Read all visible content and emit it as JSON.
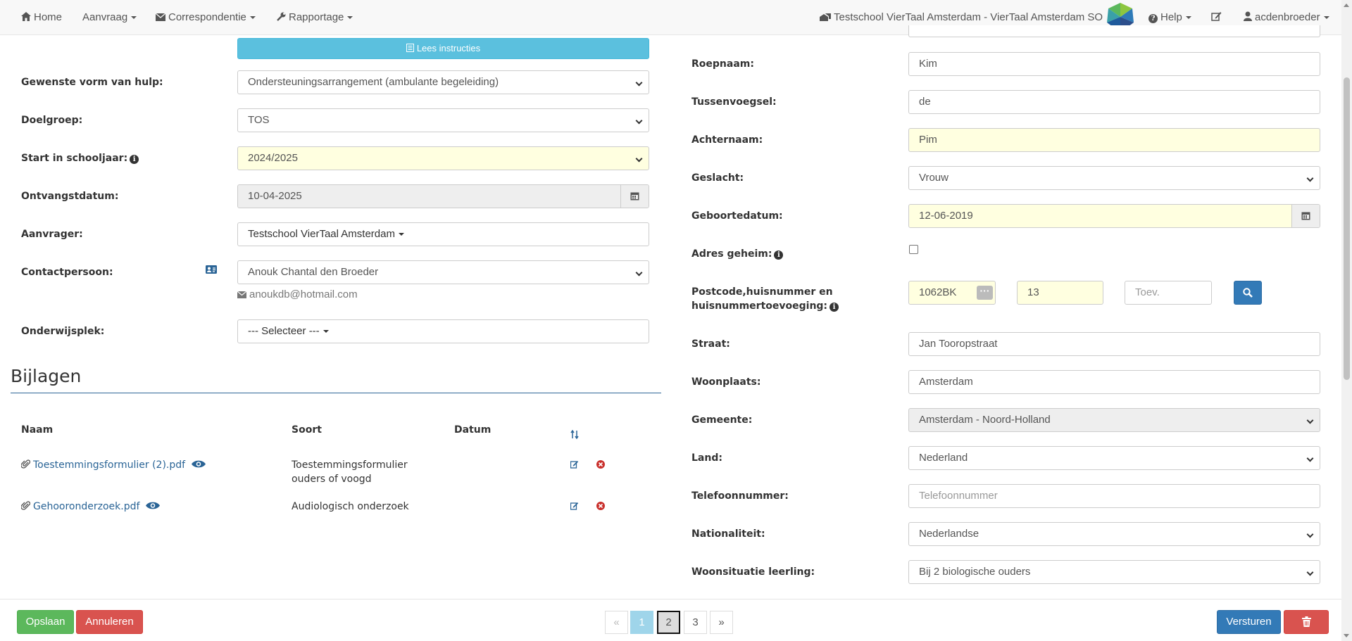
{
  "nav": {
    "home": "Home",
    "aanvraag": "Aanvraag",
    "correspondentie": "Correspondentie",
    "rapportage": "Rapportage",
    "school": "Testschool VierTaal Amsterdam - VierTaal Amsterdam SO",
    "help": "Help",
    "user": "acdenbroeder"
  },
  "left_form": {
    "instructions_button": "Lees instructies",
    "hulp_label": "Gewenste vorm van hulp:",
    "hulp_value": "Ondersteuningsarrangement (ambulante begeleiding)",
    "doelgroep_label": "Doelgroep:",
    "doelgroep_value": "TOS",
    "schooljaar_label": "Start in schooljaar:",
    "schooljaar_value": "2024/2025",
    "ontvangst_label": "Ontvangstdatum:",
    "ontvangst_value": "10-04-2025",
    "aanvrager_label": "Aanvrager:",
    "aanvrager_value": "Testschool VierTaal Amsterdam",
    "contact_label": "Contactpersoon:",
    "contact_value": "Anouk Chantal den Broeder",
    "contact_email": "anoukdb@hotmail.com",
    "onderwijsplek_label": "Onderwijsplek:",
    "onderwijsplek_value": "--- Selecteer ---"
  },
  "bijlagen": {
    "title": "Bijlagen",
    "headers": {
      "naam": "Naam",
      "soort": "Soort",
      "datum": "Datum"
    },
    "rows": [
      {
        "naam": "Toestemmingsformulier (2).pdf",
        "soort_line1": "Toestemmingsformulier",
        "soort_line2": "ouders of voogd",
        "datum": ""
      },
      {
        "naam": "Gehooronderzoek.pdf",
        "soort_line1": "Audiologisch onderzoek",
        "soort_line2": "",
        "datum": ""
      }
    ]
  },
  "right_form": {
    "roepnaam_label": "Roepnaam:",
    "roepnaam_value": "Kim",
    "tussenvoegsel_label": "Tussenvoegsel:",
    "tussenvoegsel_value": "de",
    "achternaam_label": "Achternaam:",
    "achternaam_value": "Pim",
    "geslacht_label": "Geslacht:",
    "geslacht_value": "Vrouw",
    "geboortedatum_label": "Geboortedatum:",
    "geboortedatum_value": "12-06-2019",
    "adres_geheim_label": "Adres geheim:",
    "postcode_label_line1": "Postcode,huisnummer en",
    "postcode_label_line2": "huisnummertoevoeging:",
    "postcode_value": "1062BK",
    "huisnummer_value": "13",
    "toevoeging_placeholder": "Toev.",
    "straat_label": "Straat:",
    "straat_value": "Jan Tooropstraat",
    "woonplaats_label": "Woonplaats:",
    "woonplaats_value": "Amsterdam",
    "gemeente_label": "Gemeente:",
    "gemeente_value": "Amsterdam - Noord-Holland",
    "land_label": "Land:",
    "land_value": "Nederland",
    "telefoon_label": "Telefoonnummer:",
    "telefoon_placeholder": "Telefoonnummer",
    "nationaliteit_label": "Nationaliteit:",
    "nationaliteit_value": "Nederlandse",
    "woonsituatie_label": "Woonsituatie leerling:",
    "woonsituatie_value": "Bij 2 biologische ouders"
  },
  "footer": {
    "opslaan": "Opslaan",
    "annuleren": "Annuleren",
    "prev": "«",
    "pages": [
      "1",
      "2",
      "3"
    ],
    "next": "»",
    "versturen": "Versturen"
  },
  "colors": {
    "primary": "#337ab7",
    "success": "#5cb85c",
    "danger": "#d9534f",
    "info": "#5bc0de",
    "link": "#2a6496",
    "highlight": "#ffffe0"
  }
}
